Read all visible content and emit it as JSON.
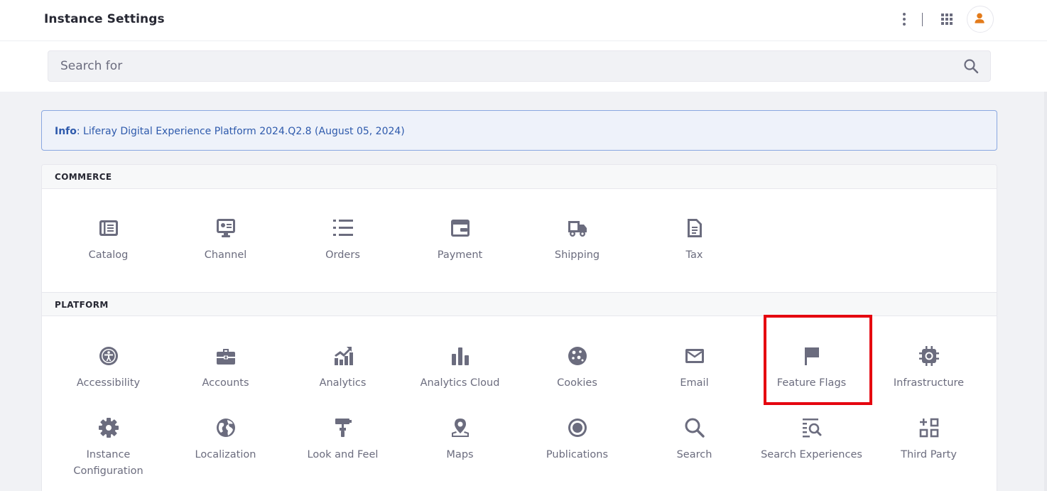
{
  "header": {
    "title": "Instance Settings",
    "menu_icon": "ellipsis-v-icon",
    "apps_icon": "grid-icon",
    "avatar_icon": "user-icon"
  },
  "search": {
    "placeholder": "Search for",
    "value": "",
    "icon": "search-icon"
  },
  "info": {
    "label": "Info",
    "message": ": Liferay Digital Experience Platform 2024.Q2.8 (August 05, 2024)"
  },
  "sections": [
    {
      "title": "COMMERCE",
      "items": [
        {
          "label": "Catalog",
          "icon": "catalog-icon"
        },
        {
          "label": "Channel",
          "icon": "channel-icon"
        },
        {
          "label": "Orders",
          "icon": "list-icon"
        },
        {
          "label": "Payment",
          "icon": "wallet-icon"
        },
        {
          "label": "Shipping",
          "icon": "truck-icon"
        },
        {
          "label": "Tax",
          "icon": "document-icon"
        }
      ]
    },
    {
      "title": "PLATFORM",
      "items": [
        {
          "label": "Accessibility",
          "icon": "accessibility-icon"
        },
        {
          "label": "Accounts",
          "icon": "briefcase-icon"
        },
        {
          "label": "Analytics",
          "icon": "analytics-icon"
        },
        {
          "label": "Analytics Cloud",
          "icon": "bar-chart-icon"
        },
        {
          "label": "Cookies",
          "icon": "cookie-icon"
        },
        {
          "label": "Email",
          "icon": "envelope-icon"
        },
        {
          "label": "Feature Flags",
          "icon": "flag-icon"
        },
        {
          "label": "Infrastructure",
          "icon": "chip-icon"
        },
        {
          "label": "Instance\nConfiguration",
          "icon": "gear-icon"
        },
        {
          "label": "Localization",
          "icon": "globe-icon"
        },
        {
          "label": "Look and Feel",
          "icon": "paint-roller-icon"
        },
        {
          "label": "Maps",
          "icon": "map-pin-icon"
        },
        {
          "label": "Publications",
          "icon": "publications-icon"
        },
        {
          "label": "Search",
          "icon": "search-icon"
        },
        {
          "label": "Search Experiences",
          "icon": "search-list-icon"
        },
        {
          "label": "Third Party",
          "icon": "add-grid-icon"
        }
      ]
    }
  ],
  "colors": {
    "accent": "#2e5aac",
    "icon": "#6b6c7e",
    "highlight": "#e5040f",
    "avatar": "#e37b1a"
  }
}
